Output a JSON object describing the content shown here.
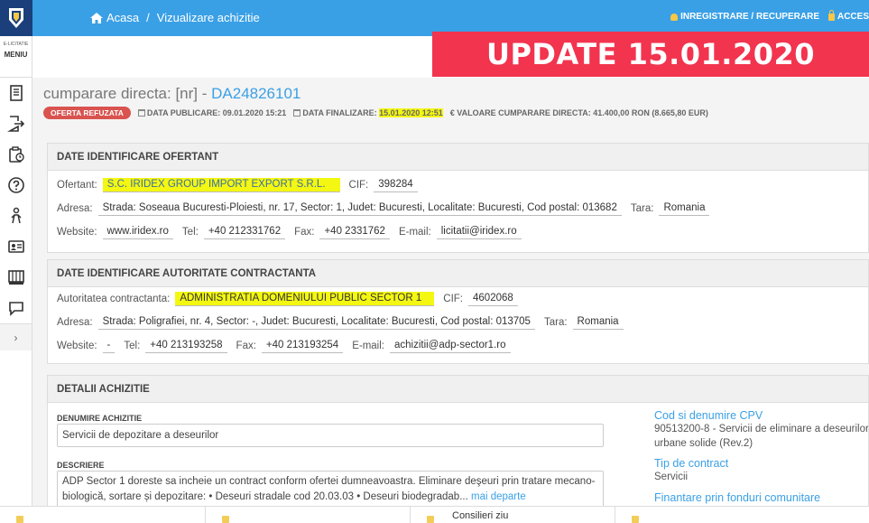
{
  "topbar": {
    "breadcrumb_home": "Acasa",
    "breadcrumb_sep": "/",
    "breadcrumb_current": "Vizualizare achizitie",
    "register_label": "INREGISTRARE / RECUPERARE",
    "access_label": "ACCES"
  },
  "banner": {
    "text": "UPDATE 15.01.2020"
  },
  "sidebar": {
    "brand_small": "E-LICITATIE",
    "menu_label": "MENIU",
    "items": [
      "document-icon",
      "export-icon",
      "clipboard-icon",
      "help-icon",
      "person-icon",
      "id-card-icon",
      "books-icon",
      "chat-icon"
    ],
    "expand": "›"
  },
  "header": {
    "title_prefix": "cumparare directa: [nr] - ",
    "title_code": "DA24826101",
    "status": "OFERTA REFUZATA",
    "publish_label": "DATA PUBLICARE:",
    "publish_value": "09.01.2020 15:21",
    "final_label": "DATA FINALIZARE:",
    "final_value": "15.01.2020 12:51",
    "value_label": "€ VALOARE CUMPARARE DIRECTA:",
    "value_value": "41.400,00  RON (8.665,80  EUR)"
  },
  "ofertant": {
    "title": "DATE IDENTIFICARE OFERTANT",
    "ofertant_label": "Ofertant:",
    "ofertant_value": "S.C. IRIDEX GROUP IMPORT EXPORT S.R.L.",
    "cif_label": "CIF:",
    "cif_value": "398284",
    "adresa_label": "Adresa:",
    "adresa_value": "Strada: Soseaua Bucuresti-Ploiesti, nr. 17, Sector: 1, Judet: Bucuresti, Localitate: Bucuresti, Cod postal: 013682",
    "tara_label": "Tara:",
    "tara_value": "Romania",
    "website_label": "Website:",
    "website_value": "www.iridex.ro",
    "tel_label": "Tel:",
    "tel_value": "+40 212331762",
    "fax_label": "Fax:",
    "fax_value": "+40 2331762",
    "email_label": "E-mail:",
    "email_value": "licitatii@iridex.ro"
  },
  "autoritate": {
    "title": "DATE IDENTIFICARE AUTORITATE CONTRACTANTA",
    "aut_label": "Autoritatea contractanta:",
    "aut_value": "ADMINISTRATIA DOMENIULUI PUBLIC SECTOR 1",
    "cif_label": "CIF:",
    "cif_value": "4602068",
    "adresa_label": "Adresa:",
    "adresa_value": "Strada: Poligrafiei, nr. 4, Sector: -, Judet: Bucuresti, Localitate: Bucuresti, Cod postal: 013705",
    "tara_label": "Tara:",
    "tara_value": "Romania",
    "website_label": "Website:",
    "website_value": "-",
    "tel_label": "Tel:",
    "tel_value": "+40 213193258",
    "fax_label": "Fax:",
    "fax_value": "+40 213193254",
    "email_label": "E-mail:",
    "email_value": "achizitii@adp-sector1.ro"
  },
  "detalii": {
    "title": "DETALII ACHIZITIE",
    "denumire_label": "DENUMIRE ACHIZITIE",
    "denumire_value": "Servicii de depozitare a deseurilor",
    "descriere_label": "DESCRIERE",
    "descriere_value": "ADP Sector 1 doreste sa incheie un contract conform ofertei dumneavoastra. Eliminare deşeuri prin tratare mecano-biologică, sortare și depozitare: • Deseuri stradale cod 20.03.03 • Deseuri biodegradab...",
    "more_label": "mai departe",
    "cpv_heading": "Cod si denumire CPV",
    "cpv_value": "90513200-8 - Servicii de eliminare a deseurilor urbane solide (Rev.2)",
    "contract_heading": "Tip de contract",
    "contract_value": "Servicii",
    "fonduri_heading": "Finantare prin fonduri comunitare"
  },
  "bottom": {
    "items": [
      "",
      "",
      "Consilieri ziu",
      ""
    ]
  },
  "colors": {
    "topbar": "#3aa0e6",
    "banner": "#f2344f",
    "highlight": "#f4f711",
    "status_badge": "#d9534f"
  }
}
